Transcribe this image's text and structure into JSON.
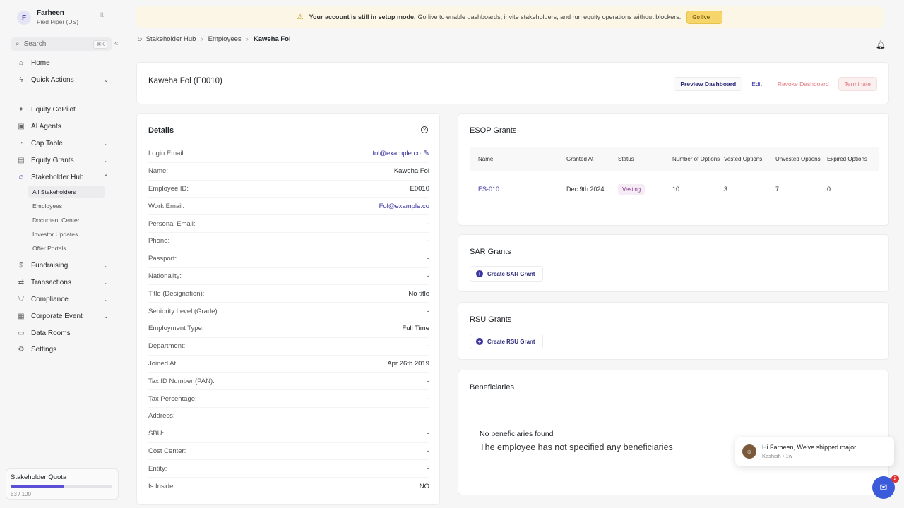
{
  "account": {
    "initial": "F",
    "name": "Farheen",
    "org": "Pied Piper (US)"
  },
  "search": {
    "label": "Search",
    "shortcut": "⌘K"
  },
  "nav": {
    "home": "Home",
    "quick_actions": "Quick Actions",
    "equity_copilot": "Equity CoPilot",
    "ai_agents": "AI Agents",
    "cap_table": "Cap Table",
    "equity_grants": "Equity Grants",
    "stakeholder_hub": "Stakeholder Hub",
    "sub": [
      "All Stakeholders",
      "Employees",
      "Document Center",
      "Investor Updates",
      "Offer Portals"
    ],
    "fundraising": "Fundraising",
    "transactions": "Transactions",
    "compliance": "Compliance",
    "corporate_event": "Corporate Event",
    "data_rooms": "Data Rooms",
    "settings": "Settings"
  },
  "quota": {
    "label": "Stakeholder Quota",
    "count": "53 / 100",
    "fraction": 0.53
  },
  "banner": {
    "bold": "Your account is still in setup mode.",
    "text": "Go live to enable dashboards, invite stakeholders, and run equity operations without blockers.",
    "button": "Go live →"
  },
  "breadcrumb": [
    "Stakeholder Hub",
    "Employees",
    "Kaweha Fol"
  ],
  "header": {
    "title": "Kaweha Fol (E0010)",
    "preview": "Preview Dashboard",
    "edit": "Edit",
    "revoke": "Revoke Dashboard",
    "terminate": "Terminate"
  },
  "details": {
    "title": "Details",
    "rows": [
      {
        "label": "Login Email:",
        "value": "fol@example.co"
      },
      {
        "label": "Name:",
        "value": "Kaweha Fol"
      },
      {
        "label": "Employee ID:",
        "value": "E0010"
      },
      {
        "label": "Work Email:",
        "value": "Fol@example.co"
      },
      {
        "label": "Personal Email:",
        "value": "-"
      },
      {
        "label": "Phone:",
        "value": "-"
      },
      {
        "label": "Passport:",
        "value": "-"
      },
      {
        "label": "Nationality:",
        "value": "-"
      },
      {
        "label": "Title (Designation):",
        "value": "No title"
      },
      {
        "label": "Seniority Level (Grade):",
        "value": "-"
      },
      {
        "label": "Employment Type:",
        "value": "Full Time"
      },
      {
        "label": "Department:",
        "value": "-"
      },
      {
        "label": "Joined At:",
        "value": "Apr 26th 2019"
      },
      {
        "label": "Tax ID Number (PAN):",
        "value": "-"
      },
      {
        "label": "Tax Percentage:",
        "value": "-"
      },
      {
        "label": "Address:",
        "value": ""
      },
      {
        "label": "SBU:",
        "value": "-"
      },
      {
        "label": "Cost Center:",
        "value": "-"
      },
      {
        "label": "Entity:",
        "value": "-"
      },
      {
        "label": "Is Insider:",
        "value": "NO"
      }
    ]
  },
  "esop": {
    "title": "ESOP Grants",
    "columns": [
      "Name",
      "Granted At",
      "Status",
      "Number of Options",
      "Vested Options",
      "Unvested Options",
      "Expired Options"
    ],
    "rows": [
      {
        "name": "ES-010",
        "granted": "Dec 9th 2024",
        "status": "Vesting",
        "options": "10",
        "vested": "3",
        "unvested": "7",
        "expired": "0"
      }
    ]
  },
  "sar": {
    "title": "SAR Grants",
    "button": "Create SAR Grant"
  },
  "rsu": {
    "title": "RSU Grants",
    "button": "Create RSU Grant"
  },
  "beneficiaries": {
    "title": "Beneficiaries",
    "empty_title": "No beneficiaries found",
    "empty_sub": "The employee has not specified any beneficiaries"
  },
  "chat": {
    "message": "Hi Farheen,  We've shipped major...",
    "meta": "Kashish • 1w",
    "badge": "2"
  }
}
